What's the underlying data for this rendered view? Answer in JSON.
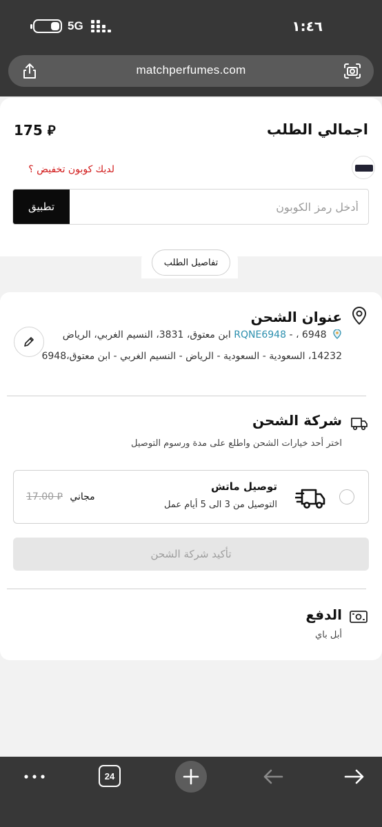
{
  "status_bar": {
    "network": "5G",
    "time": "١:٤٦"
  },
  "browser": {
    "url": "matchperfumes.com",
    "tab_count": "24"
  },
  "order_summary": {
    "total_label": "اجمالي الطلب",
    "total_value": "175 ⃁",
    "coupon_link": "لديك كوبون تخفيض ؟",
    "coupon_placeholder": "أدخل رمز الكوبون",
    "apply_label": "تطبيق",
    "details_label": "تفاصيل الطلب"
  },
  "shipping_address": {
    "title": "عنوان الشحن",
    "code": "RQNE6948",
    "line1_rest": "- ، 6948 ابن معتوق، 3831، النسيم الغربي، الرياض",
    "line2": "14232، السعودية - السعودية - الرياض - النسيم الغربي - ابن معتوق،6948"
  },
  "shipping_company": {
    "title": "شركة الشحن",
    "subtitle": "اختر أحد خيارات الشحن واطلع على مدة ورسوم التوصيل",
    "options": [
      {
        "name": "توصيل ماتش",
        "desc": "التوصيل من 3 الى 5 أيام عمل",
        "old_price": "17.00 ⃁",
        "price": "مجاني",
        "selected": false
      }
    ],
    "confirm_label": "تأكيد شركة الشحن"
  },
  "payment": {
    "title": "الدفع",
    "method": "أبل باي"
  },
  "colors": {
    "accent_red": "#d11a1a",
    "code_blue": "#2b8fae",
    "dark": "#0b0b0b",
    "chrome": "#373737"
  },
  "icons": [
    "share-icon",
    "camera-icon",
    "coupon-icon",
    "location-pin-icon",
    "edit-pencil-icon",
    "truck-icon",
    "fast-delivery-truck-icon",
    "cash-icon",
    "more-icon",
    "plus-icon",
    "back-arrow-icon",
    "forward-arrow-icon"
  ]
}
